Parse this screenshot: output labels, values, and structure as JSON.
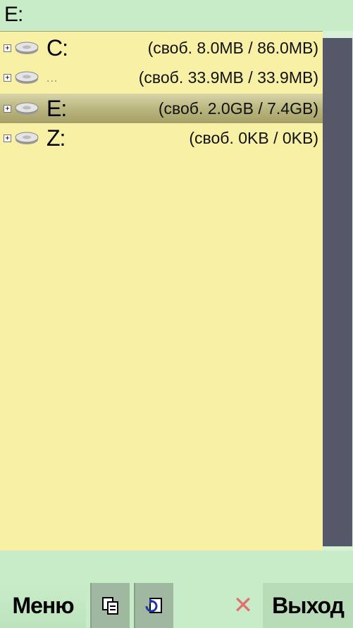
{
  "window": {
    "title": "E:"
  },
  "drives": [
    {
      "letter": "C:",
      "extra": "",
      "space": "(своб. 8.0MB / 86.0MB)",
      "selected": false
    },
    {
      "letter": "",
      "extra": "...",
      "space": "(своб. 33.9MB / 33.9MB)",
      "selected": false
    },
    {
      "letter": "E:",
      "extra": "",
      "space": "(своб. 2.0GB / 7.4GB)",
      "selected": true
    },
    {
      "letter": "Z:",
      "extra": "",
      "space": "(своб. 0KB / 0KB)",
      "selected": false
    }
  ],
  "icons": {
    "expander": "plus-box-icon",
    "drive": "hard-drive-icon",
    "copy": "copy-icon",
    "paste": "paste-icon",
    "close": "close-icon"
  },
  "softkeys": {
    "left_label": "Меню",
    "right_label": "Выход"
  },
  "colors": {
    "background": "#c8ecc8",
    "list_background": "#f8f0a4",
    "selection": "#b8b47c",
    "scroll_thumb": "#545868",
    "close_icon": "#e07070"
  }
}
